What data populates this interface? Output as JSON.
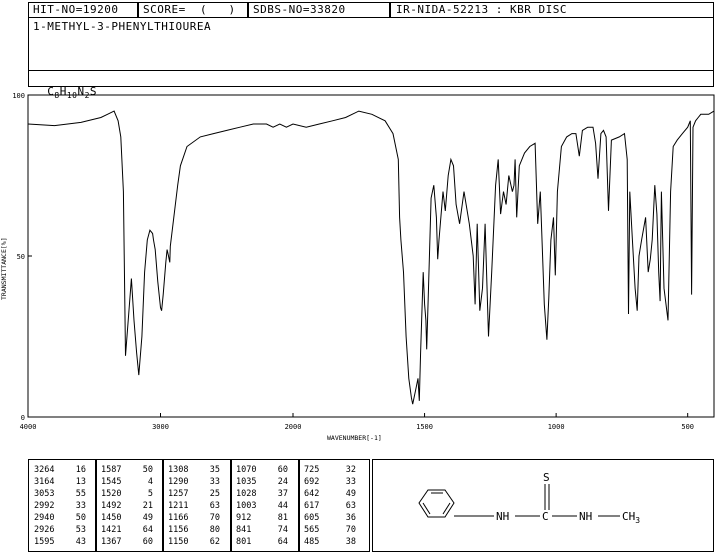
{
  "header": {
    "hit_no": "HIT-NO=19200",
    "score": "SCORE=  (   )",
    "sdbs_no": "SDBS-NO=33820",
    "ir_nida": "IR-NIDA-52213 : KBR DISC",
    "compound_name": "1-METHYL-3-PHENYLTHIOUREA",
    "formula_parts": [
      "C",
      "8",
      "H",
      "10",
      "N",
      "2",
      "S"
    ]
  },
  "chart_data": {
    "type": "line",
    "title": "",
    "xlabel": "WAVENUMBER[-1]",
    "ylabel": "TRANSMITTANCE[%]",
    "x_reversed": true,
    "xlim": [
      4000,
      400
    ],
    "ylim": [
      0,
      100
    ],
    "x_ticks": [
      4000,
      3000,
      2000,
      1500,
      1000,
      500
    ],
    "y_ticks": [
      0,
      50,
      100
    ],
    "x_ticks_display": [
      "4000",
      "3000",
      "2000",
      "1500",
      "1000",
      "500"
    ],
    "y_ticks_display": [
      "0",
      "50",
      "100"
    ],
    "grid": false,
    "series": [
      {
        "x": [
          4000,
          3800,
          3600,
          3450,
          3400,
          3350,
          3320,
          3300,
          3280,
          3264,
          3240,
          3220,
          3200,
          3180,
          3164,
          3140,
          3120,
          3100,
          3080,
          3060,
          3053,
          3040,
          3020,
          3000,
          2992,
          2980,
          2960,
          2950,
          2940,
          2930,
          2926,
          2900,
          2870,
          2850,
          2800,
          2700,
          2600,
          2500,
          2400,
          2300,
          2200,
          2150,
          2100,
          2050,
          2000,
          1950,
          1900,
          1850,
          1800,
          1750,
          1700,
          1650,
          1620,
          1600,
          1595,
          1590,
          1580,
          1570,
          1560,
          1550,
          1545,
          1535,
          1525,
          1520,
          1515,
          1505,
          1500,
          1495,
          1492,
          1485,
          1475,
          1465,
          1455,
          1450,
          1445,
          1430,
          1421,
          1410,
          1400,
          1390,
          1380,
          1367,
          1350,
          1330,
          1315,
          1308,
          1300,
          1290,
          1280,
          1270,
          1257,
          1245,
          1230,
          1220,
          1211,
          1200,
          1190,
          1180,
          1166,
          1160,
          1156,
          1150,
          1140,
          1120,
          1100,
          1080,
          1070,
          1060,
          1045,
          1035,
          1028,
          1020,
          1010,
          1003,
          995,
          980,
          960,
          940,
          925,
          912,
          900,
          880,
          860,
          850,
          841,
          830,
          820,
          810,
          801,
          790,
          760,
          740,
          730,
          725,
          720,
          710,
          700,
          692,
          685,
          675,
          660,
          650,
          642,
          635,
          625,
          617,
          610,
          605,
          600,
          590,
          575,
          565,
          555,
          540,
          520,
          500,
          495,
          490,
          485,
          480,
          470,
          460,
          450,
          420,
          400
        ],
        "y": [
          91,
          90.5,
          91.5,
          93,
          94,
          95,
          92,
          87,
          70,
          19,
          32,
          43,
          30,
          20,
          13,
          25,
          45,
          55,
          58,
          57,
          55,
          52,
          42,
          34,
          33,
          38,
          48,
          52,
          50,
          48,
          53,
          62,
          72,
          78,
          84,
          87,
          88,
          89,
          90,
          91,
          91,
          90,
          91,
          90,
          91,
          90,
          91,
          92,
          93,
          95,
          94,
          92,
          88,
          80,
          62,
          55,
          45,
          25,
          12,
          6,
          4,
          8,
          12,
          5,
          20,
          45,
          35,
          30,
          21,
          40,
          68,
          72,
          62,
          49,
          55,
          70,
          64,
          75,
          80,
          78,
          66,
          60,
          70,
          60,
          50,
          35,
          60,
          33,
          40,
          60,
          25,
          45,
          72,
          80,
          63,
          70,
          66,
          75,
          70,
          72,
          80,
          62,
          78,
          82,
          84,
          85,
          60,
          70,
          35,
          24,
          37,
          55,
          62,
          44,
          70,
          84,
          87,
          88,
          88,
          81,
          89,
          90,
          90,
          85,
          74,
          88,
          89,
          87,
          64,
          86,
          87,
          88,
          80,
          32,
          70,
          55,
          40,
          33,
          50,
          55,
          62,
          45,
          49,
          55,
          72,
          63,
          45,
          36,
          70,
          40,
          30,
          70,
          84,
          86,
          88,
          90,
          91,
          92,
          38,
          90,
          92,
          93,
          94,
          94,
          95
        ]
      }
    ]
  },
  "peak_table": {
    "columns": [
      {
        "wn": [
          "3264",
          "3164",
          "3053",
          "2992",
          "2940",
          "2926",
          "1595"
        ],
        "t": [
          "16",
          "13",
          "55",
          "33",
          "50",
          "53",
          "43"
        ]
      },
      {
        "wn": [
          "1587",
          "1545",
          "1520",
          "1492",
          "1450",
          "1421",
          "1367"
        ],
        "t": [
          "50",
          "4",
          "5",
          "21",
          "49",
          "64",
          "60"
        ]
      },
      {
        "wn": [
          "1308",
          "1290",
          "1257",
          "1211",
          "1166",
          "1156",
          "1150"
        ],
        "t": [
          "35",
          "33",
          "25",
          "63",
          "70",
          "80",
          "62"
        ]
      },
      {
        "wn": [
          "1070",
          "1035",
          "1028",
          "1003",
          "912",
          "841",
          "801"
        ],
        "t": [
          "60",
          "24",
          "37",
          "44",
          "81",
          "74",
          "64"
        ]
      },
      {
        "wn": [
          "725",
          "692",
          "642",
          "617",
          "605",
          "565",
          "485"
        ],
        "t": [
          "32",
          "33",
          "49",
          "63",
          "36",
          "70",
          "38"
        ]
      }
    ]
  },
  "structure": {
    "sulfur": "S",
    "carbon": "C",
    "nh_left": "NH",
    "nh_right": "NH",
    "methyl": "CH3"
  }
}
